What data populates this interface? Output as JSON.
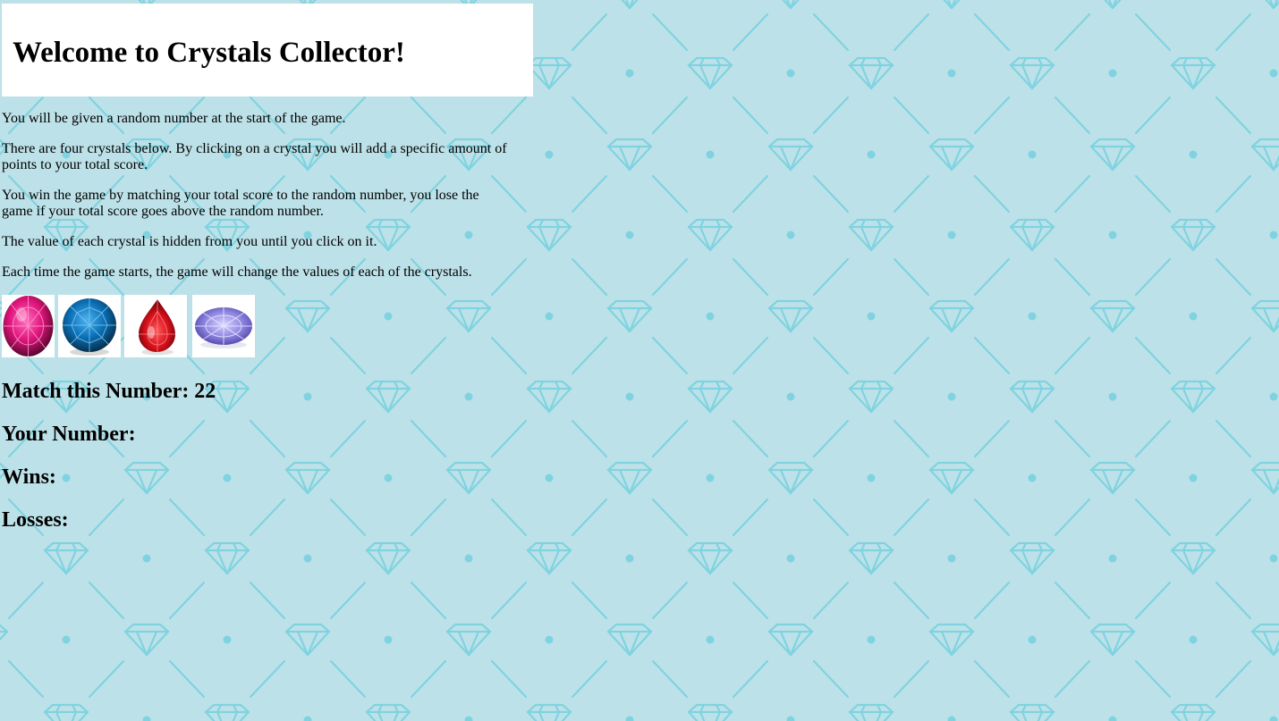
{
  "header": {
    "title": "Welcome to Crystals Collector!"
  },
  "instructions": [
    "You will be given a random number at the start of the game.",
    "There are four crystals below. By clicking on a crystal you will add a specific amount of points to your total score.",
    "You win the game by matching your total score to the random number, you lose the game if your total score goes above the random number.",
    "The value of each crystal is hidden from you until you click on it.",
    "Each time the game starts, the game will change the values of each of the crystals."
  ],
  "crystals": [
    {
      "icon": "pink-oval-gem-icon",
      "color": "#e0147a"
    },
    {
      "icon": "blue-round-gem-icon",
      "color": "#0b6fb5"
    },
    {
      "icon": "red-pear-gem-icon",
      "color": "#d40f1a"
    },
    {
      "icon": "purple-oval-gem-icon",
      "color": "#8f86e0"
    }
  ],
  "stats": {
    "match_label": "Match this Number: 22",
    "your_number_label": "Your Number:",
    "wins_label": "Wins:",
    "losses_label": "Losses:"
  },
  "theme": {
    "background": "#bde1e8",
    "pattern": "#7fd3e0"
  }
}
